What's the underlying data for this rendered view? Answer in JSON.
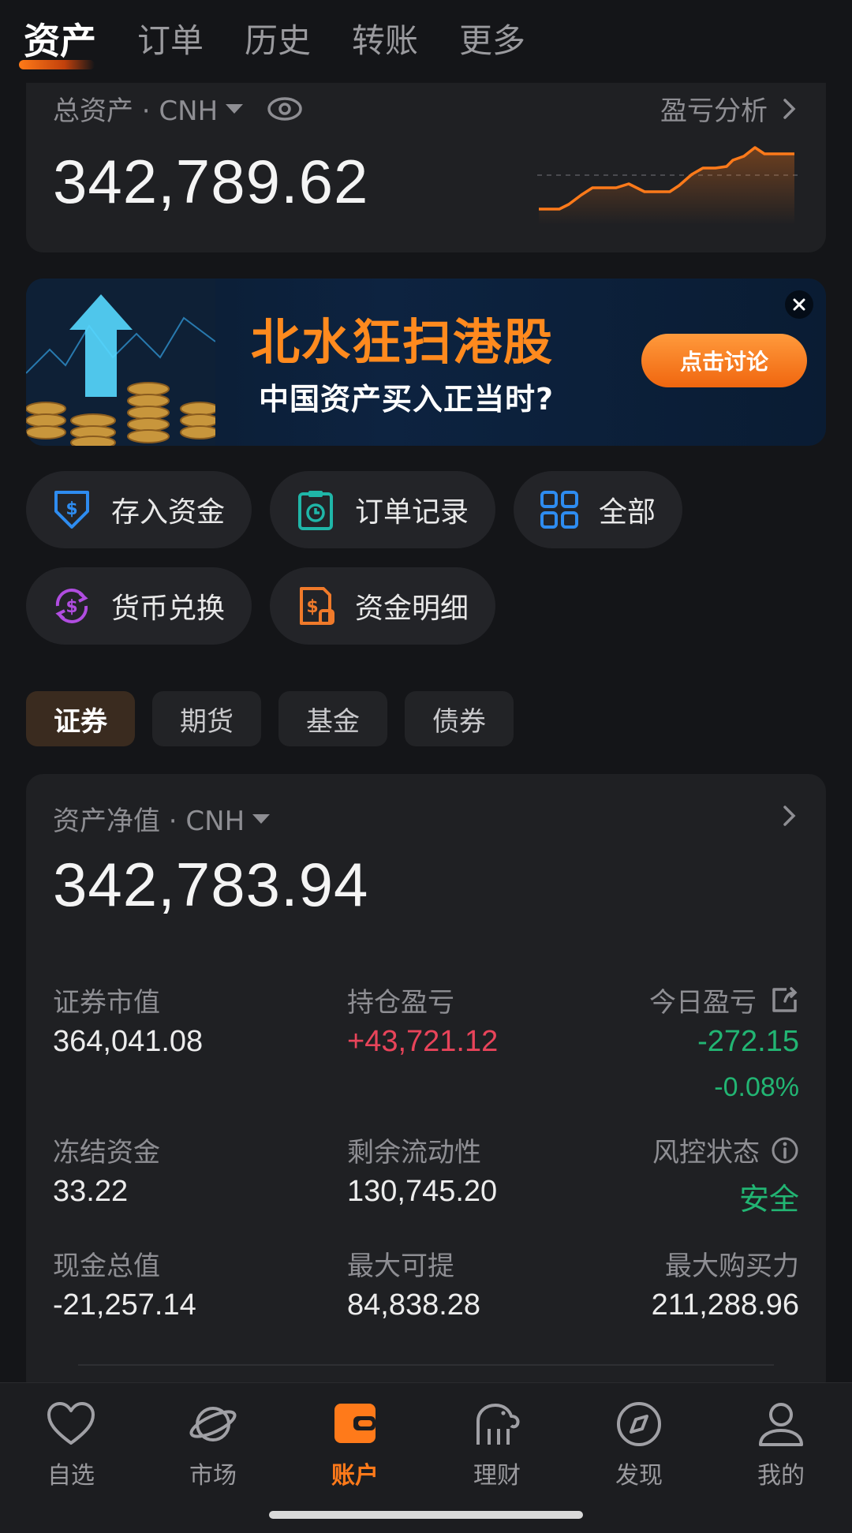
{
  "top_tabs": [
    "资产",
    "订单",
    "历史",
    "转账",
    "更多"
  ],
  "total_assets": {
    "label": "总资产 · CNH",
    "value": "342,789.62",
    "pnl_link": "盈亏分析"
  },
  "banner": {
    "headline": "北水狂扫港股",
    "subline": "中国资产买入正当时?",
    "cta": "点击讨论"
  },
  "shortcuts": [
    {
      "label": "存入资金",
      "icon": "deposit-icon"
    },
    {
      "label": "订单记录",
      "icon": "order-record-icon"
    },
    {
      "label": "全部",
      "icon": "all-grid-icon"
    },
    {
      "label": "货币兑换",
      "icon": "currency-exchange-icon"
    },
    {
      "label": "资金明细",
      "icon": "fund-detail-icon"
    }
  ],
  "segments": [
    "证券",
    "期货",
    "基金",
    "债券"
  ],
  "net_assets": {
    "label": "资产净值 · CNH",
    "value": "342,783.94",
    "stats": {
      "market_value": {
        "label": "证券市值",
        "value": "364,041.08"
      },
      "position_pnl": {
        "label": "持仓盈亏",
        "value": "+43,721.12"
      },
      "today_pnl": {
        "label": "今日盈亏",
        "value": "-272.15",
        "pct": "-0.08%"
      },
      "frozen": {
        "label": "冻结资金",
        "value": "33.22"
      },
      "liquidity": {
        "label": "剩余流动性",
        "value": "130,745.20"
      },
      "risk": {
        "label": "风控状态",
        "value": "安全"
      },
      "cash_total": {
        "label": "现金总值",
        "value": "-21,257.14"
      },
      "max_withdraw": {
        "label": "最大可提",
        "value": "84,838.28"
      },
      "max_buying": {
        "label": "最大购买力",
        "value": "211,288.96"
      }
    }
  },
  "bottom_nav": [
    {
      "label": "自选",
      "icon": "heart-icon"
    },
    {
      "label": "市场",
      "icon": "planet-icon"
    },
    {
      "label": "账户",
      "icon": "wallet-icon"
    },
    {
      "label": "理财",
      "icon": "piggy-bank-icon"
    },
    {
      "label": "发现",
      "icon": "compass-icon"
    },
    {
      "label": "我的",
      "icon": "user-icon"
    }
  ],
  "colors": {
    "accent": "#ff7a1a",
    "up": "#e8445a",
    "down": "#22b573"
  }
}
